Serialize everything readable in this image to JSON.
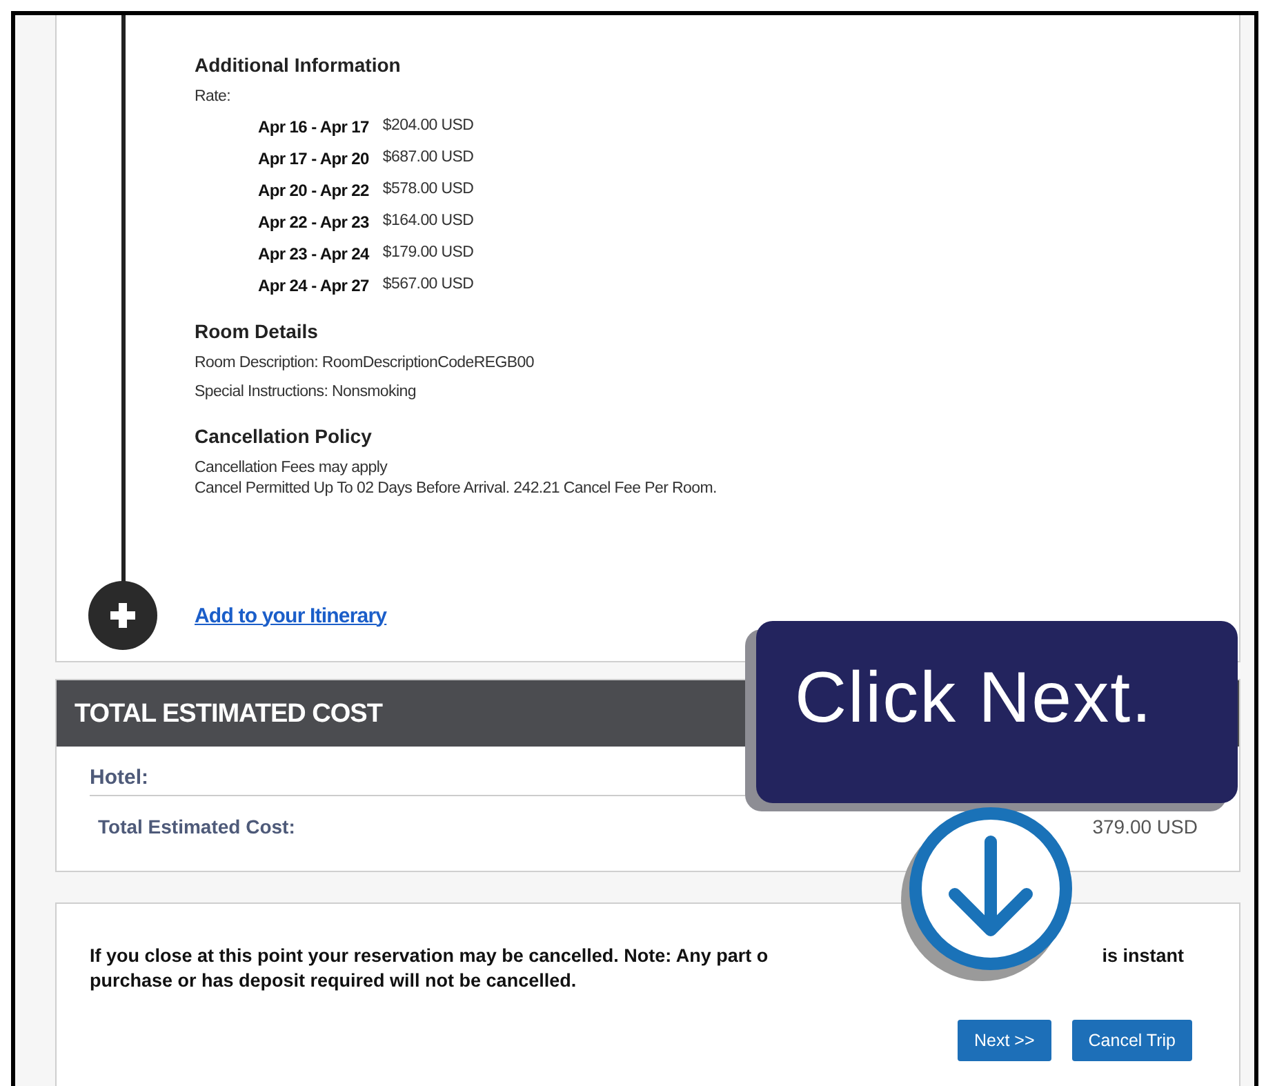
{
  "details": {
    "sections": [
      {
        "kind": "rates",
        "heading": "Additional Information",
        "label": "Rate:",
        "rates": [
          {
            "dates": "Apr 16 - Apr 17",
            "amount": "$204.00 USD"
          },
          {
            "dates": "Apr 17 - Apr 20",
            "amount": "$687.00 USD"
          },
          {
            "dates": "Apr 20 - Apr 22",
            "amount": "$578.00 USD"
          },
          {
            "dates": "Apr 22 - Apr 23",
            "amount": "$164.00 USD"
          },
          {
            "dates": "Apr 23 - Apr 24",
            "amount": "$179.00 USD"
          },
          {
            "dates": "Apr 24 - Apr 27",
            "amount": "$567.00 USD"
          }
        ]
      },
      {
        "kind": "lines",
        "heading": "Room Details",
        "lines": [
          "Room Description: RoomDescriptionCodeREGB00",
          "Special Instructions: Nonsmoking"
        ]
      },
      {
        "kind": "tight",
        "heading": "Cancellation Policy",
        "lines": [
          "Cancellation Fees may apply",
          "Cancel Permitted Up To 02 Days Before Arrival. 242.21 Cancel Fee Per Room."
        ]
      }
    ],
    "add_link": "Add to your Itinerary"
  },
  "total_cost": {
    "title": "TOTAL ESTIMATED COST",
    "rows": [
      {
        "label": "Hotel:",
        "kind": "item"
      },
      {
        "label": "Total Estimated Cost:",
        "kind": "total",
        "value": "379.00 USD"
      }
    ]
  },
  "notice": {
    "line_1_start": "If you close at this point your reservation may be cancelled. Note: Any part o",
    "line_1_end": "is instant",
    "line_2": "purchase or has deposit required will not be cancelled."
  },
  "buttons": [
    {
      "label": "Next >>"
    },
    {
      "label": "Cancel Trip"
    }
  ],
  "callout": {
    "text": "Click Next."
  }
}
